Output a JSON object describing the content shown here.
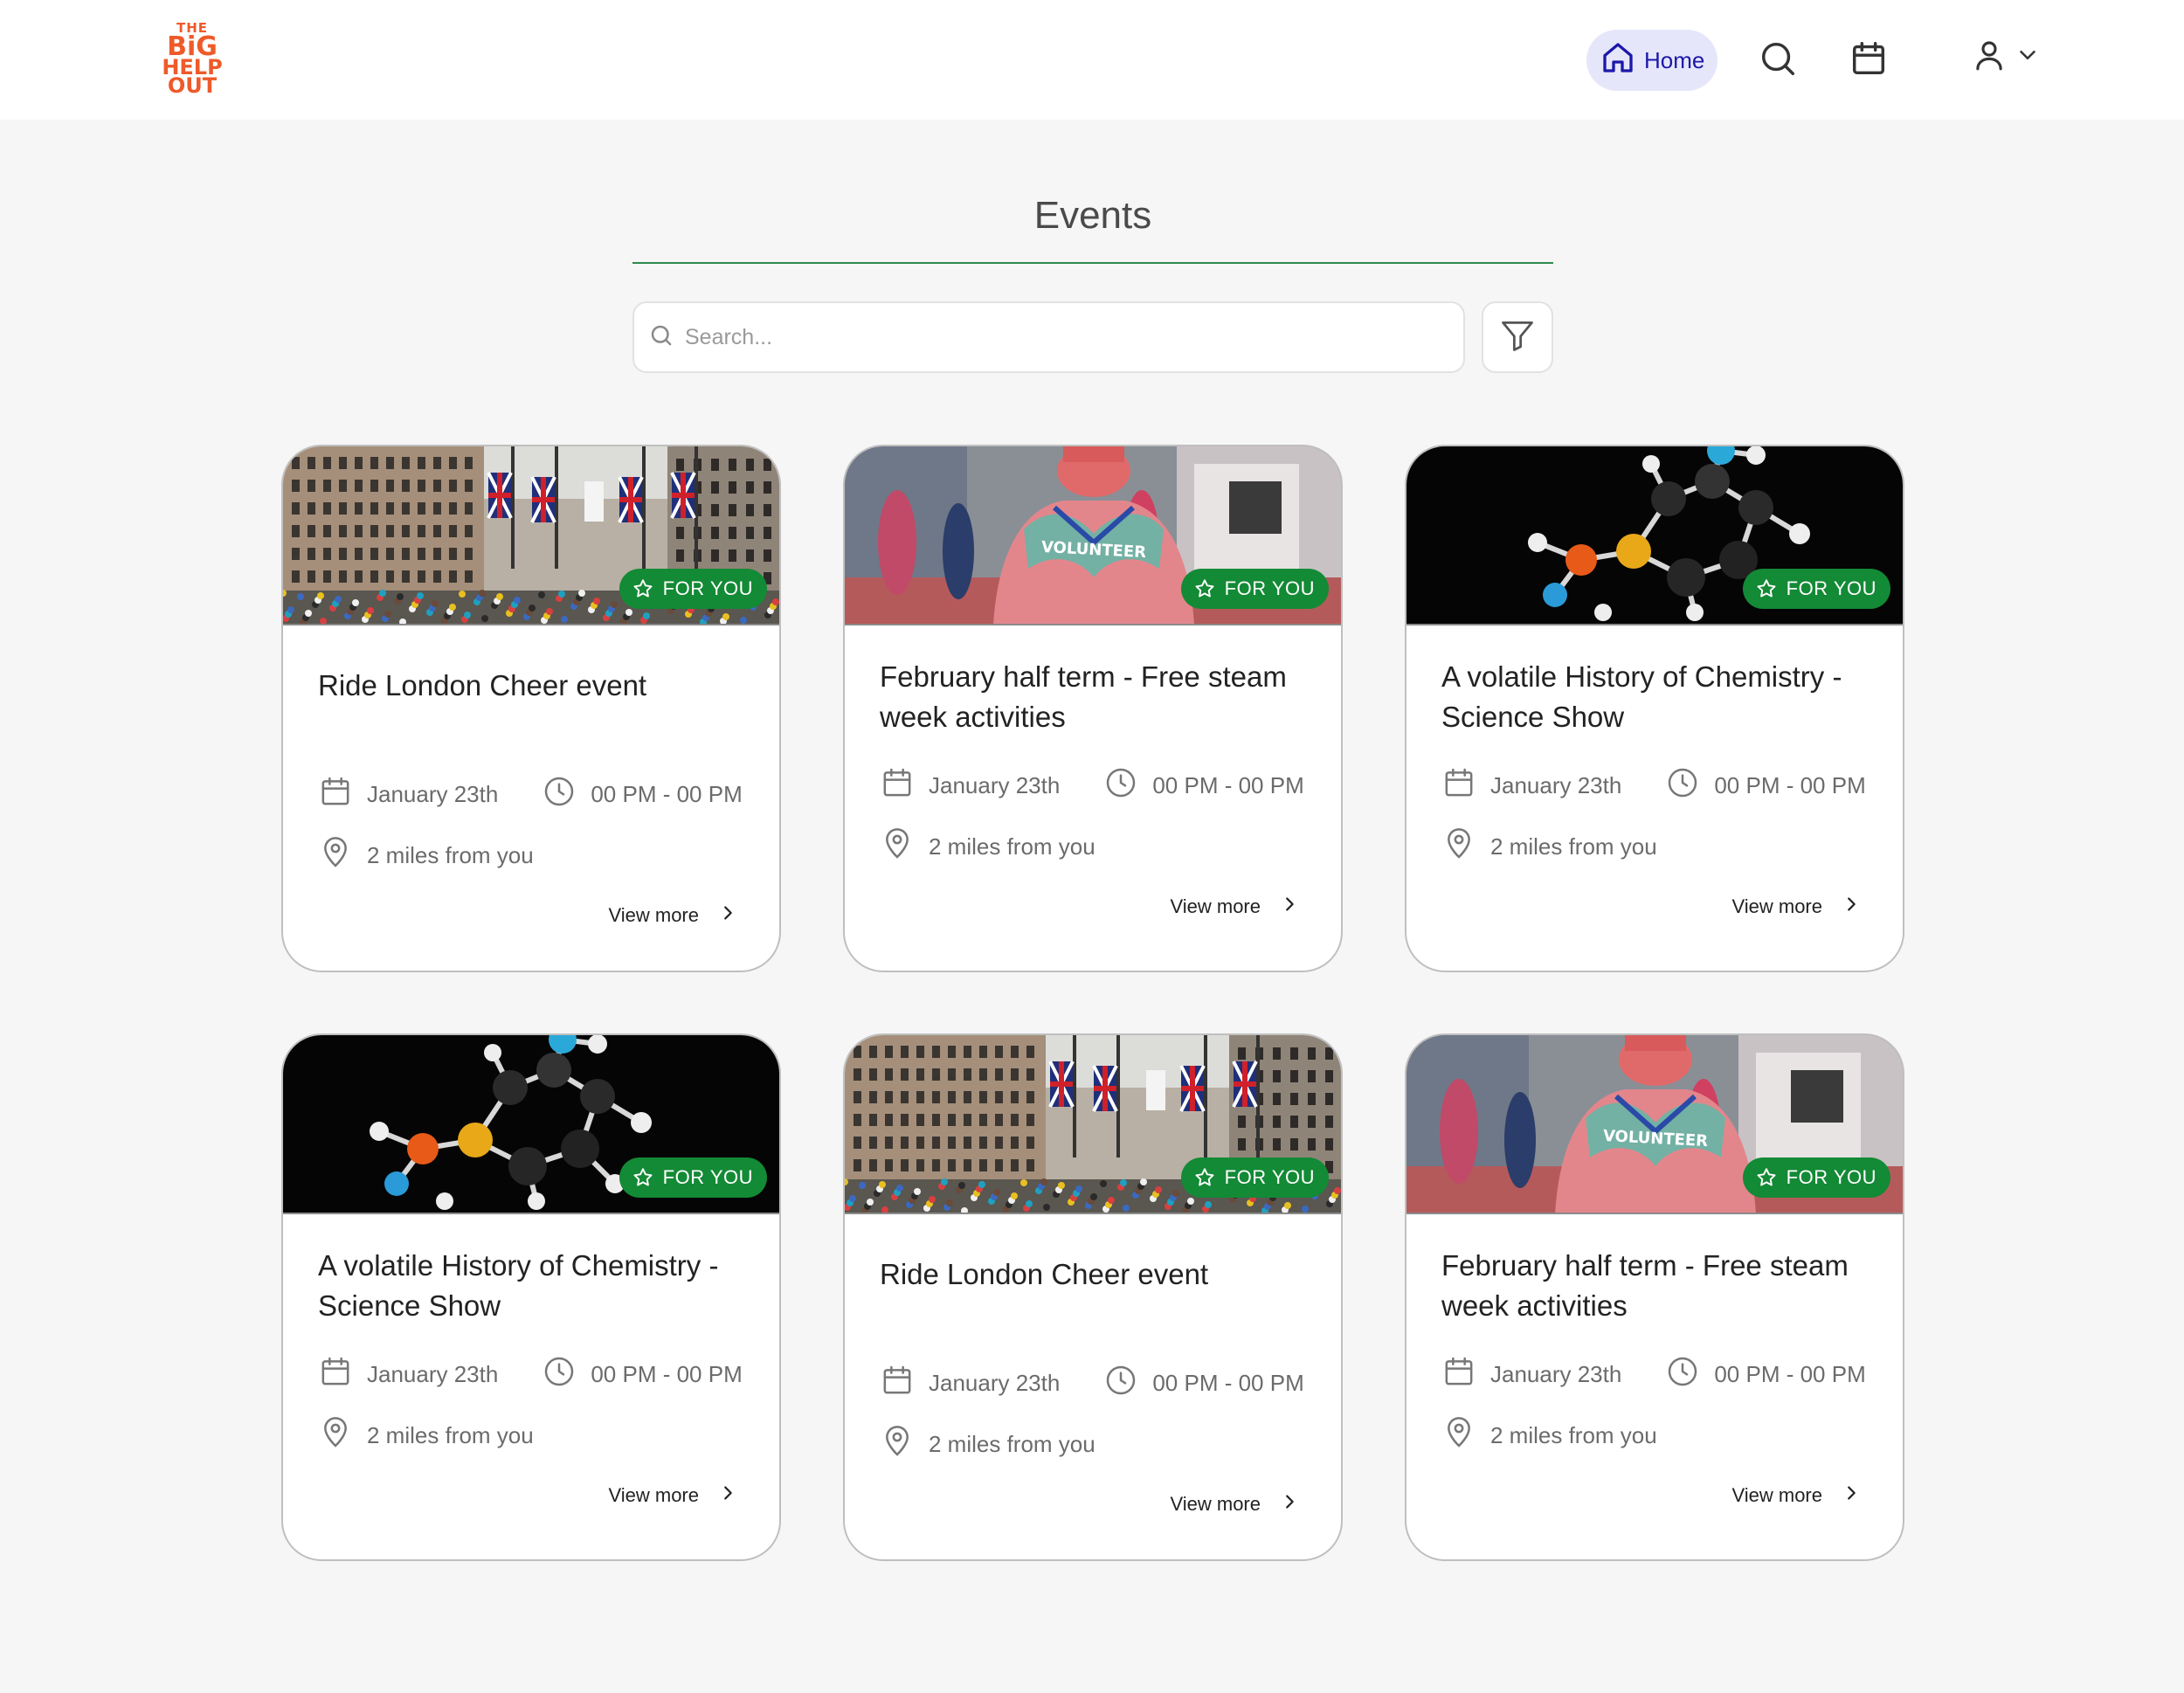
{
  "header": {
    "logo_text": [
      "THE",
      "BiG",
      "HELP",
      "OUT"
    ],
    "home_label": "Home",
    "icons": [
      "home-icon",
      "search-icon",
      "calendar-icon",
      "user-icon",
      "chevron-down-icon"
    ]
  },
  "page": {
    "title": "Events"
  },
  "search": {
    "placeholder": "Search...",
    "value": ""
  },
  "colors": {
    "badge_green": "#138a35",
    "home_active_bg": "#e6e6fb",
    "home_text": "#1c18a8",
    "title_rule": "#2f8a4e"
  },
  "cards": [
    {
      "title": "Ride London Cheer event",
      "date": "January 23th",
      "time": "00 PM - 00 PM",
      "distance": "2 miles from you",
      "badge": "FOR YOU",
      "view_more": "View more",
      "image": "london-street"
    },
    {
      "title": "February half term - Free steam week activities",
      "date": "January 23th",
      "time": "00 PM - 00 PM",
      "distance": "2 miles from you",
      "badge": "FOR YOU",
      "view_more": "View more",
      "image": "volunteer"
    },
    {
      "title": "A volatile History of Chemistry - Science Show",
      "date": "January 23th",
      "time": "00 PM - 00 PM",
      "distance": "2 miles from you",
      "badge": "FOR YOU",
      "view_more": "View more",
      "image": "molecule"
    },
    {
      "title": "A volatile History of Chemistry - Science Show",
      "date": "January 23th",
      "time": "00 PM - 00 PM",
      "distance": "2 miles from you",
      "badge": "FOR YOU",
      "view_more": "View more",
      "image": "molecule"
    },
    {
      "title": "Ride London Cheer event",
      "date": "January 23th",
      "time": "00 PM - 00 PM",
      "distance": "2 miles from you",
      "badge": "FOR YOU",
      "view_more": "View more",
      "image": "london-street"
    },
    {
      "title": "February half term - Free steam week activities",
      "date": "January 23th",
      "time": "00 PM - 00 PM",
      "distance": "2 miles from you",
      "badge": "FOR YOU",
      "view_more": "View more",
      "image": "volunteer"
    }
  ],
  "volunteer_shirt_text": "VOLUNTEER"
}
